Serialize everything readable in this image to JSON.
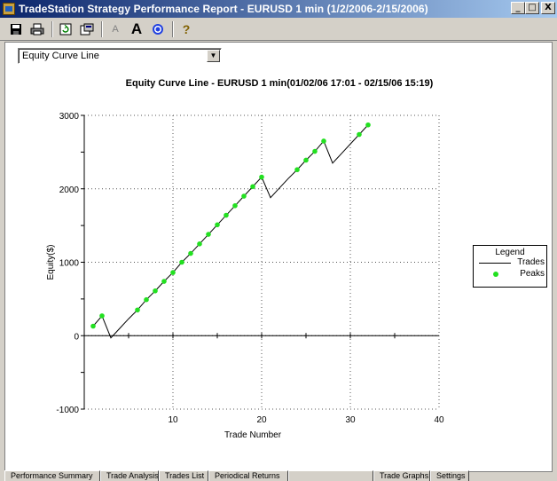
{
  "window": {
    "title": "TradeStation Strategy Performance Report - EURUSD 1 min (1/2/2006-2/15/2006)",
    "buttons": {
      "minimize": "_",
      "maximize": "□",
      "close": "X"
    }
  },
  "toolbar": {
    "icons": [
      "save-icon",
      "print-icon",
      "refresh-icon",
      "settings-icon",
      "font-small-icon",
      "font-large-icon",
      "target-icon",
      "help-icon"
    ],
    "font_small_glyph": "A",
    "font_large_glyph": "A",
    "help_glyph": "?"
  },
  "view_selector": {
    "selected": "Equity Curve Line"
  },
  "chart_title": "Equity Curve Line - EURUSD 1 min(01/02/06 17:01 - 02/15/06 15:19)",
  "legend": {
    "title": "Legend",
    "items": [
      "Trades",
      "Peaks"
    ]
  },
  "tabs": [
    "Performance Summary",
    "Trade Analysis",
    "Trades List",
    "Periodical Returns",
    "",
    "Trade Graphs",
    "Settings"
  ],
  "colors": {
    "peak": "#22e020",
    "line": "#000000",
    "titlebar_start": "#0a246a",
    "titlebar_end": "#a6caf0"
  },
  "chart_data": {
    "type": "line",
    "title": "Equity Curve Line - EURUSD 1 min(01/02/06 17:01 - 02/15/06 15:19)",
    "xlabel": "Trade Number",
    "ylabel": "Equity($)",
    "xlim": [
      0,
      40
    ],
    "ylim": [
      -1000,
      3000
    ],
    "xticks": [
      10,
      20,
      30,
      40
    ],
    "yticks": [
      -1000,
      0,
      1000,
      2000,
      3000
    ],
    "grid": "dotted",
    "legend_position": "right",
    "series": [
      {
        "name": "Trades",
        "x": [
          1,
          2,
          3,
          4,
          5,
          6,
          7,
          8,
          9,
          10,
          11,
          12,
          13,
          14,
          15,
          16,
          17,
          18,
          19,
          20,
          21,
          22,
          23,
          24,
          25,
          26,
          27,
          28,
          29,
          30,
          31,
          32
        ],
        "y": [
          130,
          270,
          -30,
          100,
          230,
          350,
          490,
          610,
          740,
          860,
          1000,
          1120,
          1250,
          1380,
          1510,
          1640,
          1770,
          1900,
          2030,
          2160,
          1880,
          2010,
          2140,
          2260,
          2390,
          2510,
          2650,
          2350,
          2480,
          2610,
          2740,
          2870
        ]
      },
      {
        "name": "Peaks",
        "x": [
          1,
          2,
          6,
          7,
          8,
          9,
          10,
          11,
          12,
          13,
          14,
          15,
          16,
          17,
          18,
          19,
          20,
          24,
          25,
          26,
          27,
          31,
          32
        ],
        "y": [
          130,
          270,
          350,
          490,
          610,
          740,
          860,
          1000,
          1120,
          1250,
          1380,
          1510,
          1640,
          1770,
          1900,
          2030,
          2160,
          2260,
          2390,
          2510,
          2650,
          2740,
          2870
        ]
      }
    ]
  }
}
